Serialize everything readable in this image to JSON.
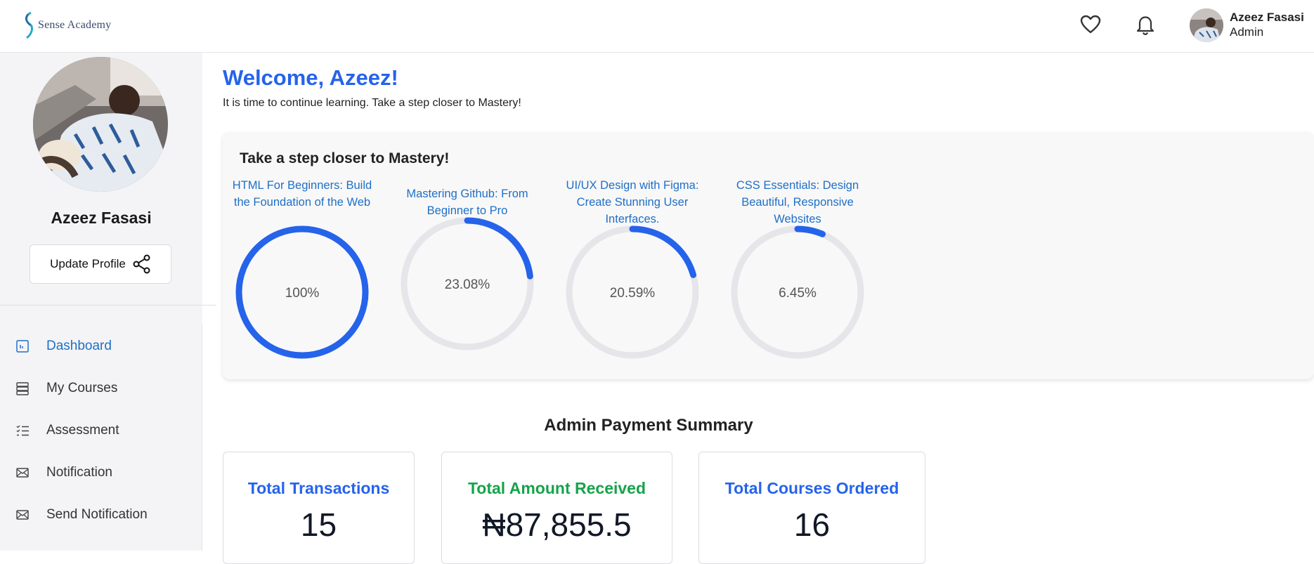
{
  "header": {
    "logo_text": "Sense Academy",
    "user_name": "Azeez Fasasi",
    "user_role": "Admin",
    "icons": [
      "heart-icon",
      "bell-icon"
    ]
  },
  "sidebar": {
    "profile_name": "Azeez Fasasi",
    "update_profile_label": "Update Profile",
    "items": [
      {
        "label": "Dashboard",
        "icon": "dashboard-icon",
        "active": true
      },
      {
        "label": "My Courses",
        "icon": "courses-icon",
        "active": false
      },
      {
        "label": "Assessment",
        "icon": "checklist-icon",
        "active": false
      },
      {
        "label": "Notification",
        "icon": "mail-icon",
        "active": false
      },
      {
        "label": "Send Notification",
        "icon": "mail-icon",
        "active": false
      }
    ]
  },
  "main": {
    "welcome": "Welcome, Azeez!",
    "subtitle": "It is time to continue learning. Take a step closer to Mastery!",
    "mastery": {
      "title": "Take a step closer to Mastery!",
      "courses": [
        {
          "title": "HTML For Beginners: Build the Foundation of the Web",
          "progress_label": "100%",
          "progress": 1.0
        },
        {
          "title": "Mastering Github: From Beginner to Pro",
          "progress_label": "23.08%",
          "progress": 0.2308
        },
        {
          "title": "UI/UX Design with Figma: Create Stunning User Interfaces.",
          "progress_label": "20.59%",
          "progress": 0.2059
        },
        {
          "title": "CSS Essentials: Design Beautiful, Responsive Websites",
          "progress_label": "6.45%",
          "progress": 0.0645
        }
      ]
    },
    "payment": {
      "title": "Admin Payment Summary",
      "stats": [
        {
          "label": "Total Transactions",
          "value": "15",
          "color": "#2563eb"
        },
        {
          "label": "Total Amount Received",
          "value": "₦87,855.5",
          "color": "#16a34a"
        },
        {
          "label": "Total Courses Ordered",
          "value": "16",
          "color": "#2563eb"
        }
      ]
    }
  },
  "colors": {
    "accent": "#2563eb",
    "link": "#1f6fc7",
    "track": "#e5e5ea",
    "success": "#16a34a"
  }
}
